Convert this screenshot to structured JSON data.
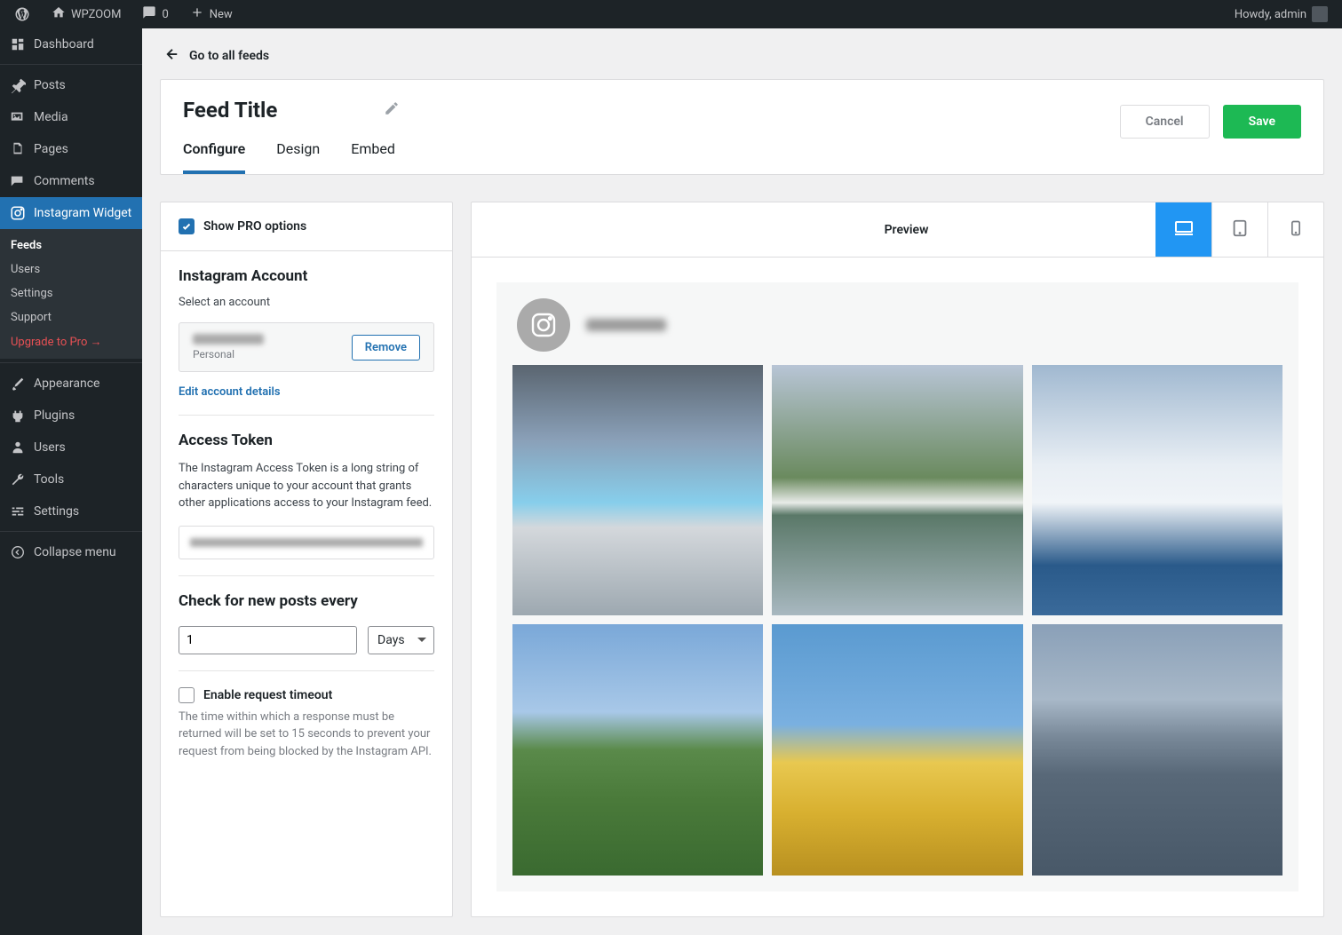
{
  "adminBar": {
    "siteName": "WPZOOM",
    "commentsCount": "0",
    "newLabel": "New",
    "howdy": "Howdy, admin"
  },
  "sidebar": {
    "dashboard": "Dashboard",
    "posts": "Posts",
    "media": "Media",
    "pages": "Pages",
    "comments": "Comments",
    "instagramWidget": "Instagram Widget",
    "submenu": {
      "feeds": "Feeds",
      "users": "Users",
      "settings": "Settings",
      "support": "Support",
      "upgrade": "Upgrade to Pro →"
    },
    "appearance": "Appearance",
    "plugins": "Plugins",
    "users": "Users",
    "tools": "Tools",
    "settings": "Settings",
    "collapse": "Collapse menu"
  },
  "backLink": "Go to all feeds",
  "header": {
    "title": "Feed Title",
    "tabs": {
      "configure": "Configure",
      "design": "Design",
      "embed": "Embed"
    },
    "cancel": "Cancel",
    "save": "Save"
  },
  "settings": {
    "showPro": "Show PRO options",
    "account": {
      "title": "Instagram Account",
      "sub": "Select an account",
      "type": "Personal",
      "remove": "Remove",
      "editLink": "Edit account details"
    },
    "token": {
      "title": "Access Token",
      "desc": "The Instagram Access Token is a long string of characters unique to your account that grants other applications access to your Instagram feed."
    },
    "check": {
      "title": "Check for new posts every",
      "value": "1",
      "unit": "Days"
    },
    "timeout": {
      "label": "Enable request timeout",
      "desc": "The time within which a response must be returned will be set to 15 seconds to prevent your request from being blocked by the Instagram API."
    }
  },
  "preview": {
    "title": "Preview"
  }
}
